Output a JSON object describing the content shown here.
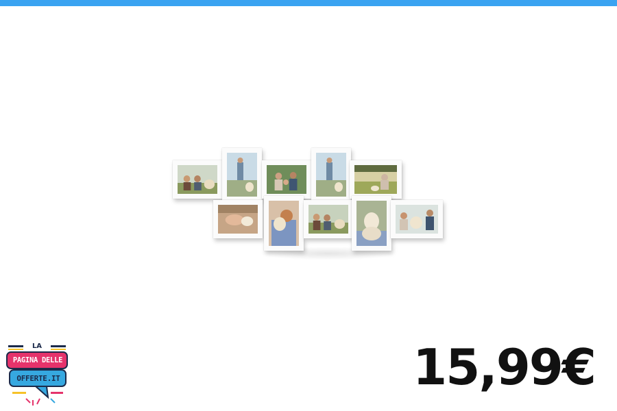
{
  "header": {
    "accent_color": "#3aa3f1"
  },
  "product": {
    "image_description_icon": "photo-collage-frame-icon",
    "frame_color": "#fbfbfb",
    "price": "15,99€"
  },
  "logo": {
    "top_text": "LA",
    "line1": "PAGINA DELLE",
    "line2": "OFFERTE.IT",
    "colors": {
      "pink": "#e5336b",
      "blue": "#36a8e0",
      "navy": "#1b2a4a",
      "yellow": "#f6c228"
    }
  }
}
